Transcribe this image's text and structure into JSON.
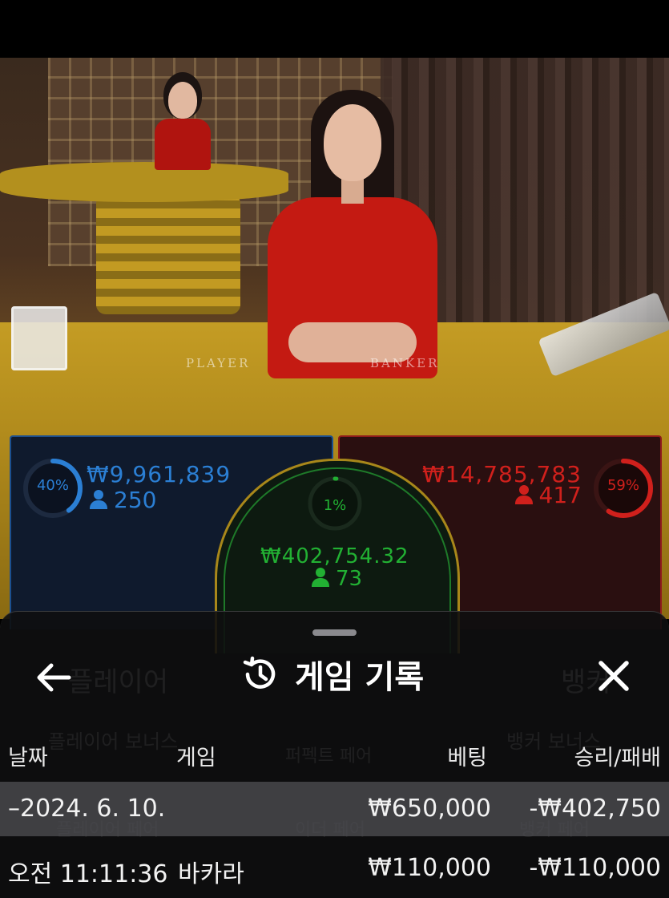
{
  "scene": {
    "felt_player_label": "PLAYER",
    "felt_banker_label": "BANKER"
  },
  "bets": {
    "player": {
      "percent": 40,
      "percent_label": "40%",
      "amount": "₩9,961,839",
      "count": "250",
      "color": "#2b7fd4"
    },
    "tie": {
      "percent": 1,
      "percent_label": "1%",
      "amount": "₩402,754.32",
      "count": "73",
      "color": "#22b033"
    },
    "banker": {
      "percent": 59,
      "percent_label": "59%",
      "amount": "₩14,785,783",
      "count": "417",
      "color": "#d0201c"
    }
  },
  "background_labels": {
    "player": "플레이어",
    "banker": "뱅커",
    "player_bonus": "플레이어 보너스",
    "perfect_pair": "퍼펙트 페어",
    "banker_bonus": "뱅커 보너스",
    "player_pair": "플레이어 페어",
    "either_pair": "이더 페어",
    "banker_pair": "뱅커 페어"
  },
  "sheet": {
    "title": "게임 기록",
    "back_icon": "arrow-left-icon",
    "title_icon": "history-icon",
    "close_icon": "close-icon",
    "columns": {
      "date": "날짜",
      "game": "게임",
      "bet": "베팅",
      "win_loss": "승리/패배"
    },
    "date_row": {
      "date": "–2024. 6. 10.",
      "bet": "₩650,000",
      "win_loss": "-₩402,750"
    },
    "rows": [
      {
        "time": "오전 11:11:36",
        "game": "바카라",
        "bet": "₩110,000",
        "win_loss": "-₩110,000"
      }
    ]
  }
}
